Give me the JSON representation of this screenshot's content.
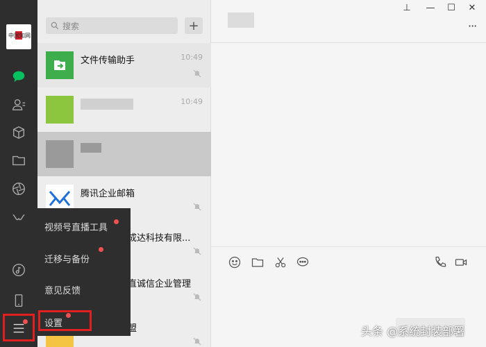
{
  "avatar": {
    "text": "中国知网"
  },
  "search": {
    "placeholder": "搜索",
    "add_label": "+"
  },
  "chats": [
    {
      "name": "文件传输助手",
      "time": "10:49"
    },
    {
      "name": "",
      "time": "10:49"
    },
    {
      "name": "",
      "time": ""
    },
    {
      "name": "腾讯企业邮箱",
      "time": ""
    },
    {
      "name": "成达科技有限...",
      "time": ""
    },
    {
      "name": "直诚信企业管理",
      "time": ""
    },
    {
      "name": "盟",
      "time": ""
    }
  ],
  "popup_menu": [
    {
      "label": "视频号直播工具"
    },
    {
      "label": "迁移与备份"
    },
    {
      "label": "意见反馈"
    },
    {
      "label": "设置"
    }
  ],
  "window": {
    "pin": "⊥",
    "minimize": "—",
    "maximize": "☐",
    "close": "✕",
    "more": "···"
  },
  "watermark": "头条 @系统封装部署",
  "colors": {
    "rail": "#2e2e2e",
    "accent": "#07c160",
    "highlight": "#e02020",
    "badge": "#f05050"
  }
}
